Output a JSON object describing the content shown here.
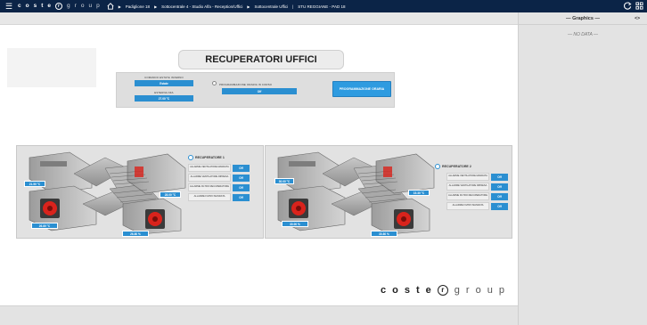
{
  "topbar": {
    "brand_bold": [
      "c",
      "o",
      "s",
      "t",
      "e"
    ],
    "brand_r": "r",
    "brand_light": [
      "g",
      "r",
      "o",
      "u",
      "p"
    ],
    "crumbs": [
      "Padiglione 18",
      "Sottocentrale 4 - Studio Alfa - Reception/Uffici",
      "Sottocentrale Uffici",
      "STU REGGIANE - PAD 18"
    ]
  },
  "rightpane": {
    "title": "— Graphics —",
    "code": "<>",
    "nodata": "— NO DATA —"
  },
  "page": {
    "title": "RECUPERATORI UFFICI"
  },
  "controls": {
    "comando_label": "COMANDO ESTATE INVERNO",
    "comando_value": "Estate",
    "esterna_label": "ESTERNA NFA",
    "esterna_value": "27.00 °C",
    "progr_label": "PROGRAMMAZIONE ORARIA IN CORSO",
    "progr_value": "Off",
    "progr_button": "PROGRAMMAZIONE ORARIA"
  },
  "recuperatori": [
    {
      "title": "RECUPERATORE 1",
      "temps": [
        "21.50 °C",
        "28.00 °C",
        "26.80 °C",
        "26.80 %"
      ],
      "alarms": [
        {
          "label": "ALLARME VENTILATORE MANDATA",
          "state": "Off"
        },
        {
          "label": "ALLARME VENTILATORE RIPRESA",
          "state": "Off"
        },
        {
          "label": "ALLARME FILTRO RECUPERATORE",
          "state": "Off"
        },
        {
          "label": "ALLARME FILTRO MANDATA",
          "state": "Off"
        }
      ]
    },
    {
      "title": "RECUPERATORE 2",
      "temps": [
        "30.00 °C",
        "15.30 °C",
        "30.00 %",
        "30.80 %"
      ],
      "alarms": [
        {
          "label": "ALLARME VENTILATORE MANDATA",
          "state": "Off"
        },
        {
          "label": "ALLARME VENTILATORE RIPRESA",
          "state": "Off"
        },
        {
          "label": "ALLARME FILTRO RECUPERATORE",
          "state": "Off"
        },
        {
          "label": "ALLARME FILTRO MANDATA",
          "state": "Off"
        }
      ]
    }
  ],
  "footer": {
    "bold": [
      "c",
      "o",
      "s",
      "t",
      "e"
    ],
    "r": "r",
    "light": [
      "g",
      "r",
      "o",
      "u",
      "p"
    ]
  },
  "colors": {
    "topbar": "#0b2447",
    "accent": "#2b8fd1",
    "fan": "#d9231c"
  }
}
